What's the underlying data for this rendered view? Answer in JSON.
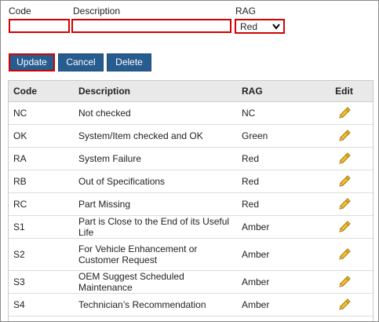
{
  "form": {
    "code_label": "Code",
    "description_label": "Description",
    "rag_label": "RAG",
    "code_value": "",
    "description_value": "",
    "rag_selected": "Red"
  },
  "buttons": {
    "update": "Update",
    "cancel": "Cancel",
    "delete": "Delete"
  },
  "table": {
    "headers": {
      "code": "Code",
      "description": "Description",
      "rag": "RAG",
      "edit": "Edit"
    },
    "rows": [
      {
        "code": "NC",
        "description": "Not checked",
        "rag": "NC"
      },
      {
        "code": "OK",
        "description": "System/Item checked and OK",
        "rag": "Green"
      },
      {
        "code": "RA",
        "description": "System Failure",
        "rag": "Red"
      },
      {
        "code": "RB",
        "description": "Out of Specifications",
        "rag": "Red"
      },
      {
        "code": "RC",
        "description": "Part Missing",
        "rag": "Red"
      },
      {
        "code": "S1",
        "description": "Part is Close to the End of its Useful Life",
        "rag": "Amber"
      },
      {
        "code": "S2",
        "description": "For Vehicle Enhancement or Customer Request",
        "rag": "Amber"
      },
      {
        "code": "S3",
        "description": "OEM Suggest Scheduled Maintenance",
        "rag": "Amber"
      },
      {
        "code": "S4",
        "description": "Technician’s Recommendation",
        "rag": "Amber"
      }
    ]
  },
  "colors": {
    "button_bg": "#275c8f",
    "highlight_border": "#d40000",
    "header_bg": "#e9e9e9",
    "pencil": "#e0a81c"
  },
  "icons": {
    "edit": "pencil-icon",
    "dropdown": "chevron-down-icon"
  }
}
